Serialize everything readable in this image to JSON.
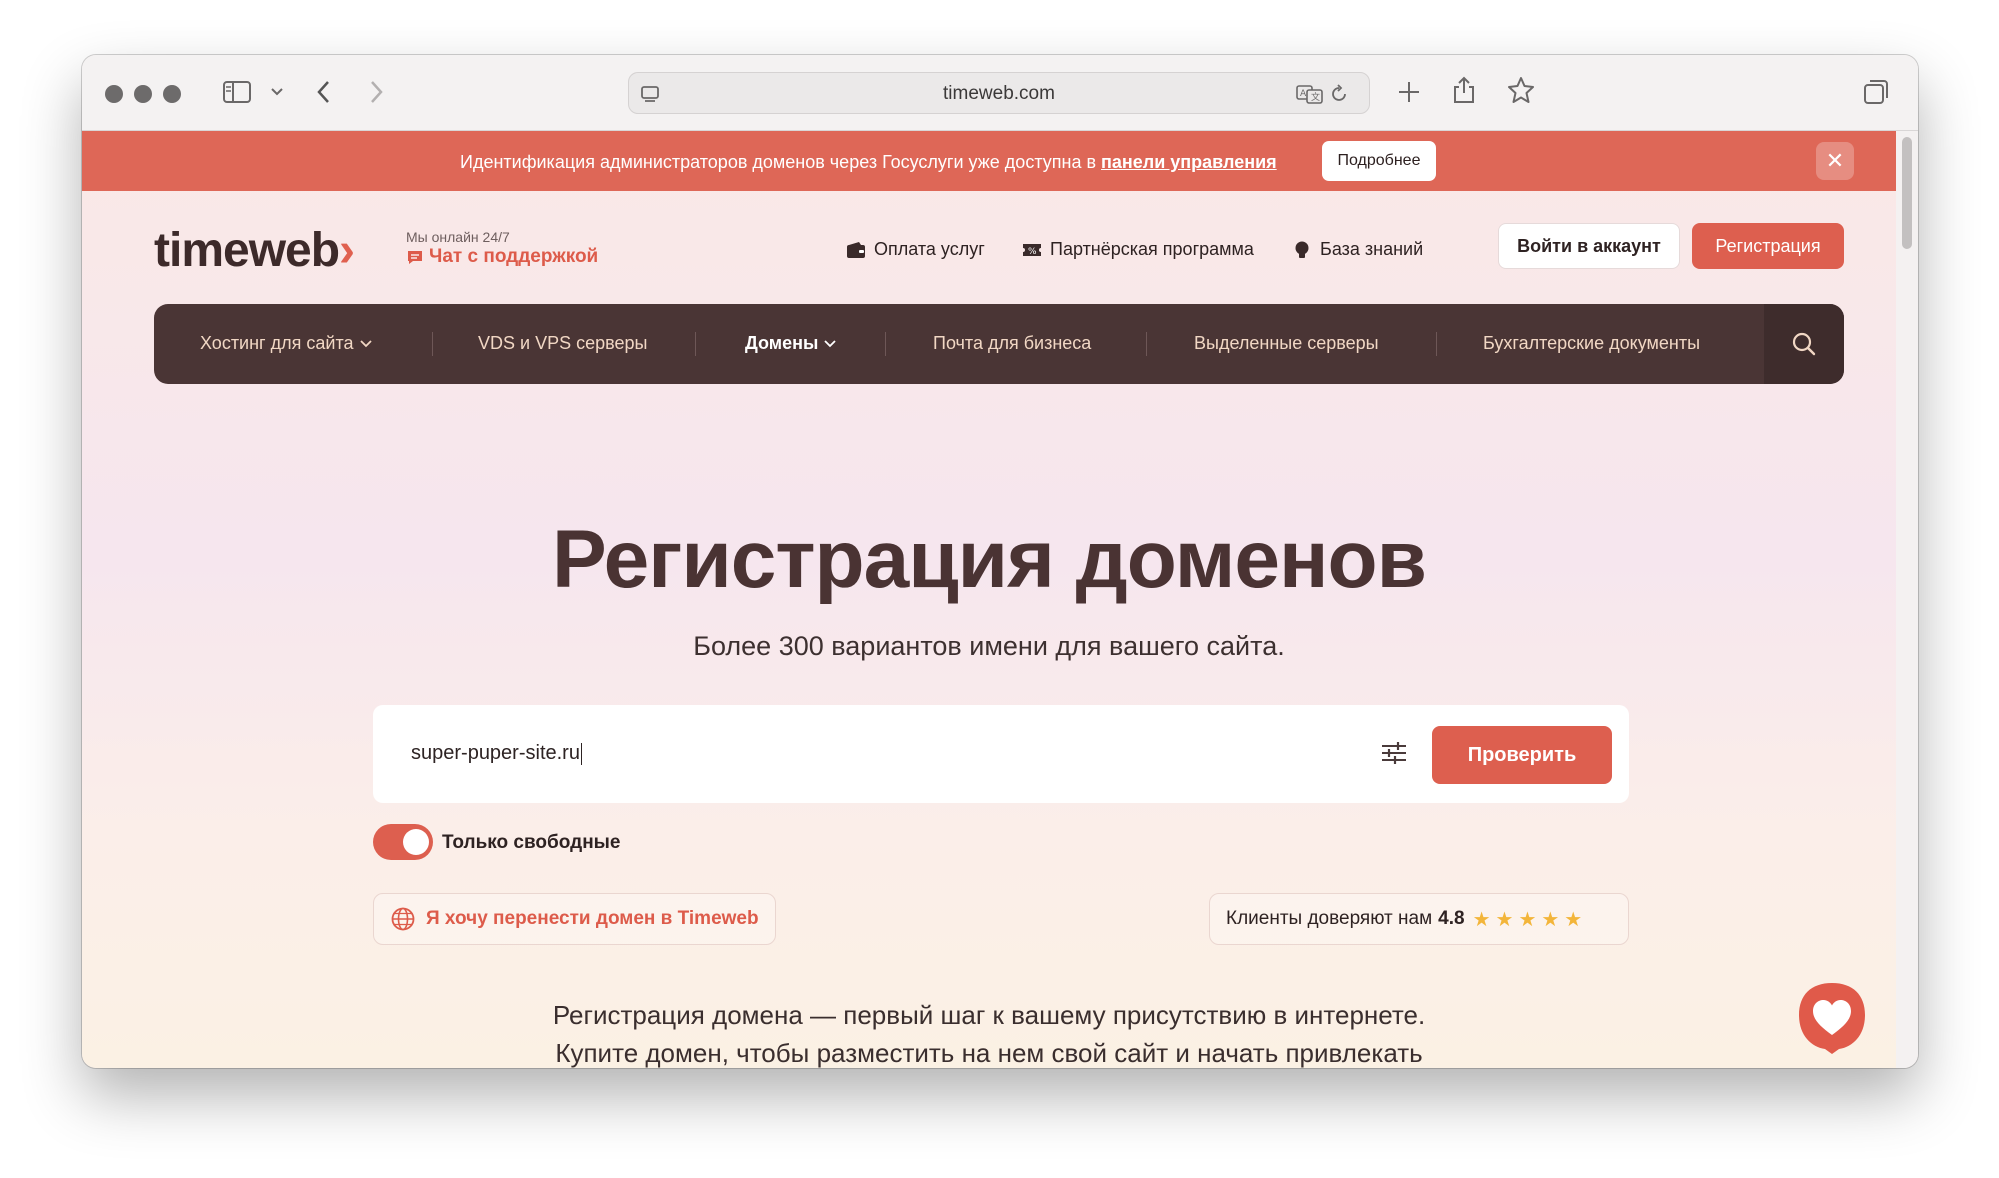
{
  "browser": {
    "url": "timeweb.com"
  },
  "banner": {
    "text": "Идентификация администраторов доменов через Госуслуги уже доступна в ",
    "link": "панели управления",
    "more_button": "Подробнее",
    "close_icon": "✕"
  },
  "header": {
    "logo": "timeweb",
    "online_text": "Мы онлайн 24/7",
    "chat_link": "Чат с поддержкой",
    "nav": {
      "payment": "Оплата услуг",
      "partner": "Партнёрская программа",
      "knowledge": "База знаний"
    },
    "login_button": "Войти в аккаунт",
    "register_button": "Регистрация"
  },
  "mainnav": {
    "items": [
      "Хостинг для сайта",
      "VDS и VPS серверы",
      "Домены",
      "Почта для бизнеса",
      "Выделенные серверы",
      "Бухгалтерские документы"
    ]
  },
  "hero": {
    "title": "Регистрация доменов",
    "subtitle": "Более 300 вариантов имени для вашего сайта."
  },
  "search": {
    "value": "super-puper-site.ru",
    "button": "Проверить"
  },
  "filter": {
    "toggle_label": "Только свободные",
    "toggle_on": true
  },
  "transfer": {
    "label": "Я хочу перенести домен в Timeweb"
  },
  "trust": {
    "text": "Клиенты доверяют нам",
    "rating": "4.8",
    "stars": "★★★★★"
  },
  "intro": {
    "line1": "Регистрация домена — первый шаг к вашему присутствию в интернете.",
    "line2": "Купите домен, чтобы разместить на нем свой сайт и начать привлекать"
  },
  "colors": {
    "accent": "#dd5f4f",
    "nav_bg": "#4a3535",
    "banner_bg": "#de6757",
    "star": "#f3b53a"
  }
}
